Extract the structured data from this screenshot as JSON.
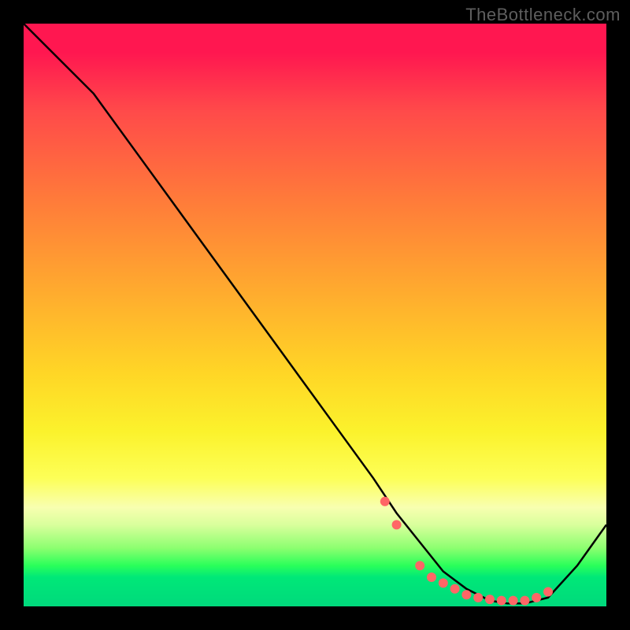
{
  "watermark": "TheBottleneck.com",
  "chart_data": {
    "type": "line",
    "title": "",
    "xlabel": "",
    "ylabel": "",
    "xlim": [
      0,
      100
    ],
    "ylim": [
      0,
      100
    ],
    "series": [
      {
        "name": "bottleneck-curve",
        "x": [
          0,
          4,
          12,
          20,
          28,
          36,
          44,
          52,
          60,
          64,
          68,
          72,
          76,
          80,
          83,
          86,
          90,
          95,
          100
        ],
        "y": [
          100,
          96,
          88,
          77,
          66,
          55,
          44,
          33,
          22,
          16,
          11,
          6,
          3,
          1,
          0.5,
          0.5,
          1.5,
          7,
          14
        ]
      }
    ],
    "markers": {
      "name": "highlight-dots",
      "color": "#ff6666",
      "x": [
        62,
        64,
        68,
        70,
        72,
        74,
        76,
        78,
        80,
        82,
        84,
        86,
        88,
        90
      ],
      "y": [
        18,
        14,
        7,
        5,
        4,
        3,
        2,
        1.5,
        1.2,
        1.0,
        1.0,
        1.0,
        1.5,
        2.5
      ]
    }
  }
}
